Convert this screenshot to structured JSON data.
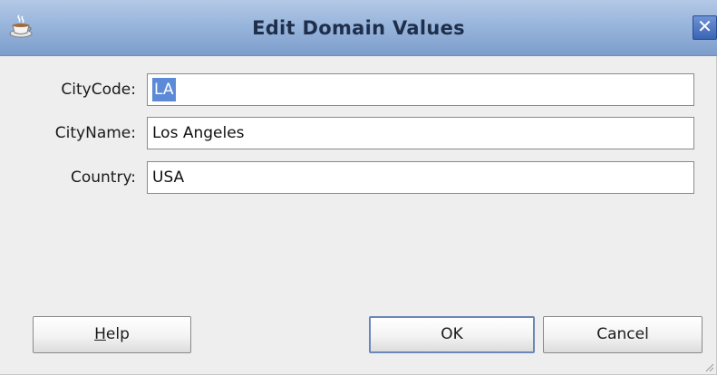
{
  "window": {
    "title": "Edit Domain Values",
    "app_icon": "coffee-cup-icon",
    "close_glyph": "✕"
  },
  "form": {
    "fields": [
      {
        "label": "CityCode:",
        "value": "LA",
        "selected": true
      },
      {
        "label": "CityName:",
        "value": "Los Angeles",
        "selected": false
      },
      {
        "label": "Country:",
        "value": "USA",
        "selected": false
      }
    ]
  },
  "buttons": {
    "help": {
      "mnemonic": "H",
      "rest": "elp"
    },
    "ok": "OK",
    "cancel": "Cancel"
  },
  "colors": {
    "titlebar": "#98b5dc",
    "selection": "#5c8ad6",
    "dialog_bg": "#eeeeee"
  }
}
